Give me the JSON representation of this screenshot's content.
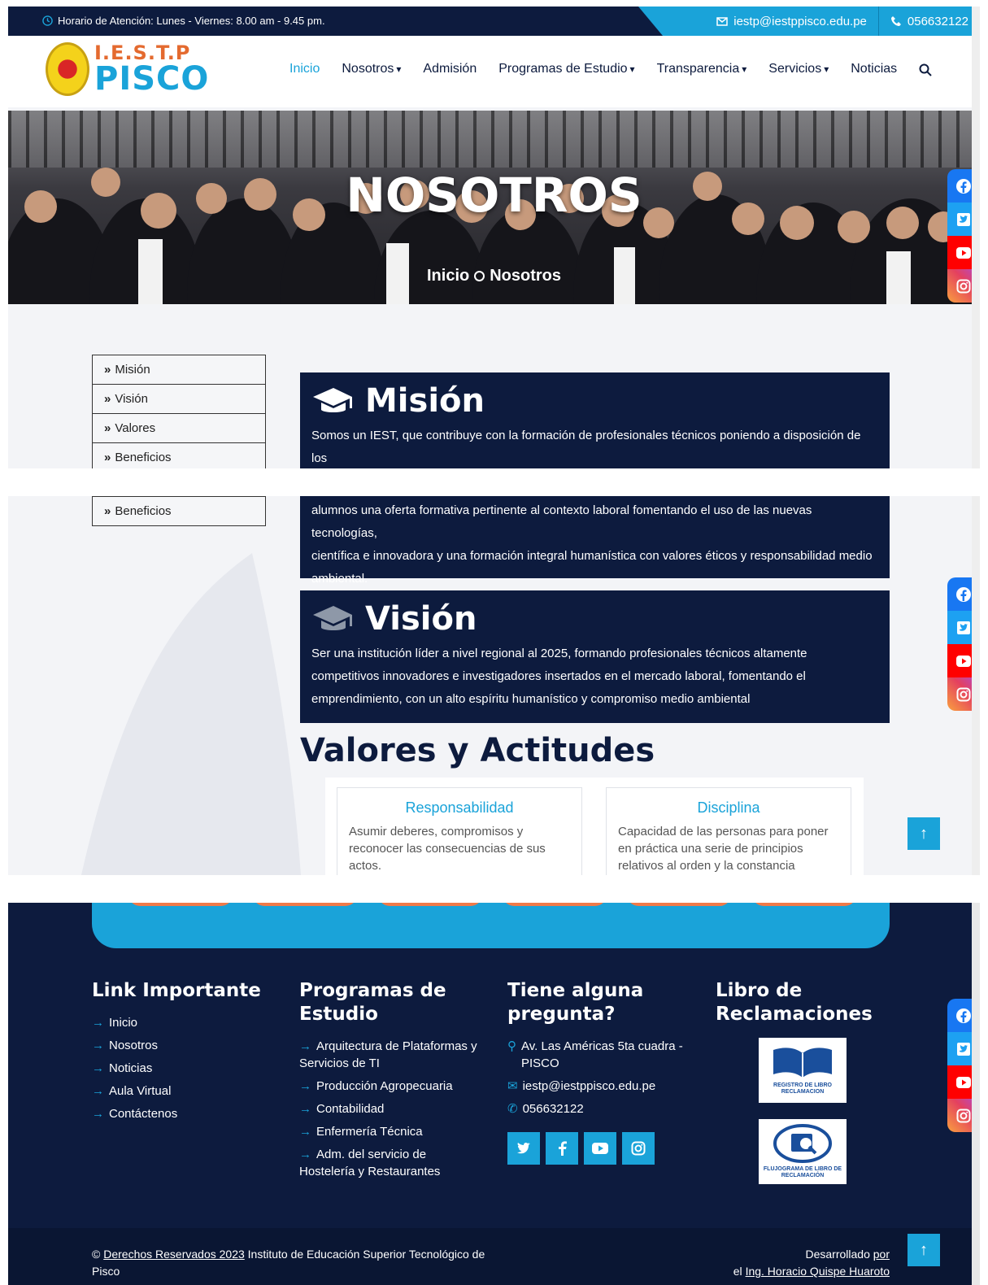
{
  "topbar": {
    "hours": "Horario de Atención: Lunes - Viernes: 8.00 am - 9.45 pm.",
    "email": "iestp@iestppisco.edu.pe",
    "phone": "056632122"
  },
  "header": {
    "logo_line1": "I.E.S.T.P",
    "logo_line2": "PISCO",
    "nav": [
      "Inicio",
      "Nosotros",
      "Admisión",
      "Programas de Estudio",
      "Transparencia",
      "Servicios",
      "Noticias"
    ]
  },
  "hero": {
    "title": "NOSOTROS",
    "crumb_home": "Inicio",
    "crumb_current": "Nosotros"
  },
  "sidemenu": [
    "Misión",
    "Visión",
    "Valores",
    "Beneficios"
  ],
  "mision": {
    "title": "Misión",
    "text_part1": "Somos un IEST, que contribuye con la formación de profesionales técnicos poniendo a disposición de los",
    "text_part2": "alumnos una oferta formativa pertinente al contexto laboral fomentando el uso de las nuevas tecnologías,",
    "text_part3": "científica e innovadora y una formación integral humanística con valores éticos y responsabilidad medio ambiental."
  },
  "vision": {
    "title": "Visión",
    "text": "Ser una institución líder a nivel regional al 2025, formando profesionales técnicos altamente competitivos innovadores e investigadores insertados en el mercado laboral, fomentando el emprendimiento, con un alto espíritu humanístico y compromiso medio ambiental"
  },
  "valores": {
    "title": "Valores y Actitudes",
    "items": [
      {
        "name": "Responsabilidad",
        "text": "Asumir deberes, compromisos y reconocer las consecuencias de sus actos."
      },
      {
        "name": "Disciplina",
        "text": "Capacidad de las personas para poner en práctica una serie de principios relativos al orden y la constancia"
      }
    ]
  },
  "footer": {
    "links_title": "Link Importante",
    "links": [
      "Inicio",
      "Nosotros",
      "Noticias",
      "Aula Virtual",
      "Contáctenos"
    ],
    "programs_title_1": "Programas de",
    "programs_title_2": "Estudio",
    "programs": [
      "Arquitectura de Plataformas y Servicios de TI",
      "Producción Agropecuaria",
      "Contabilidad",
      "Enfermería Técnica",
      "Adm. del servicio de Hostelería y Restaurantes"
    ],
    "question_title_1": "Tiene alguna",
    "question_title_2": "pregunta?",
    "address": "Av. Las Américas 5ta cuadra - PISCO",
    "email": "iestp@iestppisco.edu.pe",
    "phone": "056632122",
    "libro_title_1": "Libro de",
    "libro_title_2": "Reclamaciones",
    "libro_img1": "REGISTRO DE LIBRO RECLAMACION",
    "libro_img2": "FLUJOGRAMA DE LIBRO DE RECLAMACIÓN",
    "copy_prefix": "©",
    "copy_link": "Derechos Reservados 2023",
    "copy_rest": "Instituto de Educación Superior Tecnológico de Pisco",
    "dev_prefix": "Desarrollado",
    "dev_por": "por",
    "dev_el": "el",
    "dev_name": "Ing. Horacio Quispe Huaroto"
  },
  "icons": {
    "clock": "clock-icon",
    "mail": "mail-icon",
    "phone": "phone-icon",
    "search": "search-icon",
    "facebook": "facebook-icon",
    "twitter": "twitter-icon",
    "youtube": "youtube-icon",
    "instagram": "instagram-icon",
    "cap": "graduation-cap-icon",
    "arrow_up": "arrow-up-icon"
  },
  "colors": {
    "navy": "#0d1b3e",
    "accent": "#1aa3d9",
    "orange": "#f07a48"
  }
}
